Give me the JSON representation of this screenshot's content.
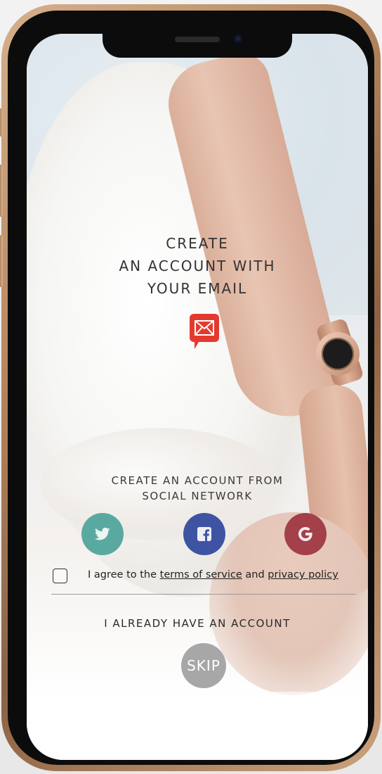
{
  "title": {
    "line1": "CREATE",
    "line2": "AN ACCOUNT WITH",
    "line3": "YOUR EMAIL"
  },
  "email_button": {
    "icon": "envelope-icon",
    "color": "#e33a2f"
  },
  "social": {
    "title_line1": "CREATE AN ACCOUNT FROM",
    "title_line2": "SOCIAL NETWORK",
    "networks": [
      {
        "icon": "twitter-icon",
        "color": "#5aa9a0"
      },
      {
        "icon": "facebook-icon",
        "color": "#3e54a3"
      },
      {
        "icon": "google-icon",
        "color": "#a3404a"
      }
    ]
  },
  "agreement": {
    "prefix": "I agree to the ",
    "terms": "terms of service",
    "middle": " and ",
    "privacy": "privacy policy"
  },
  "have_account_label": "I ALREADY HAVE AN ACCOUNT",
  "skip_label": "SKIP"
}
